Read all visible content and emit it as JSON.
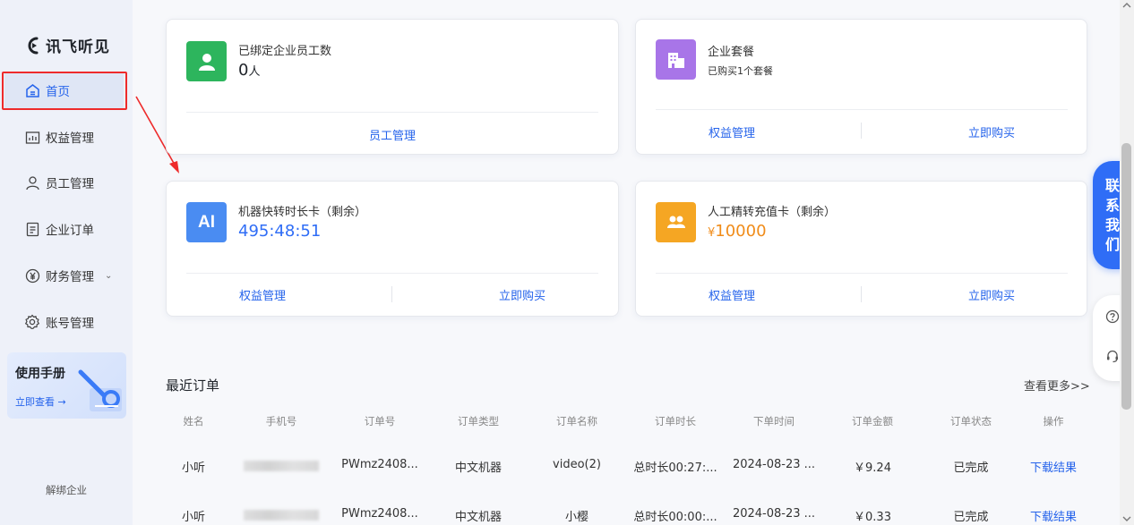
{
  "sidebar": {
    "logo_text": "讯飞听见",
    "items": [
      {
        "label": "首页",
        "icon": "home-icon",
        "active": true
      },
      {
        "label": "权益管理",
        "icon": "chart-icon"
      },
      {
        "label": "员工管理",
        "icon": "user-icon"
      },
      {
        "label": "企业订单",
        "icon": "document-icon"
      },
      {
        "label": "财务管理",
        "icon": "yen-icon"
      },
      {
        "label": "账号管理",
        "icon": "gear-icon"
      }
    ],
    "manual": {
      "title": "使用手册",
      "link": "立即查看 →"
    },
    "unbind": "解绑企业"
  },
  "cards": {
    "employees": {
      "title": "已绑定企业员工数",
      "value": "0",
      "unit": "人",
      "link": "员工管理",
      "icon": "person-icon",
      "color": "#2db55d"
    },
    "package": {
      "title": "企业套餐",
      "sub": "已购买1个套餐",
      "link1": "权益管理",
      "link2": "立即购买",
      "icon": "building-icon",
      "color": "#a875e8"
    },
    "machine": {
      "title": "机器快转时长卡（剩余）",
      "value": "495:48:51",
      "link1": "权益管理",
      "link2": "立即购买",
      "icon": "ai-icon",
      "icon_text": "AI",
      "color": "#4a8cf2"
    },
    "manual_card": {
      "title": "人工精转充值卡（剩余）",
      "currency": "¥",
      "value": "10000",
      "link1": "权益管理",
      "link2": "立即购买",
      "icon": "group-icon",
      "color": "#f5a623"
    }
  },
  "orders": {
    "title": "最近订单",
    "more": "查看更多>>",
    "columns": [
      "姓名",
      "手机号",
      "订单号",
      "订单类型",
      "订单名称",
      "订单时长",
      "下单时间",
      "订单金额",
      "订单状态",
      "操作"
    ],
    "rows": [
      {
        "name": "小听",
        "order_no": "PWmz2408...",
        "type": "中文机器",
        "order_name": "video(2)",
        "duration": "总时长00:27:...",
        "time": "2024-08-23 ...",
        "amount": "￥9.24",
        "status": "已完成",
        "action": "下载结果"
      },
      {
        "name": "小听",
        "order_no": "PWmz2408...",
        "type": "中文机器",
        "order_name": "小樱",
        "duration": "总时长00:00:...",
        "time": "2024-08-23 ...",
        "amount": "￥0.33",
        "status": "已完成",
        "action": "下载结果"
      }
    ]
  },
  "float": {
    "contact": [
      "联",
      "系",
      "我",
      "们"
    ],
    "help_icon": "question-icon",
    "service_icon": "headset-icon"
  }
}
